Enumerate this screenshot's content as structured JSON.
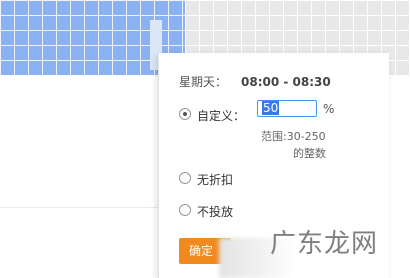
{
  "popup": {
    "day_label": "星期天：",
    "time_range": "08:00 - 08:30",
    "custom_label": "自定义：",
    "custom_value": "50",
    "percent_sign": "%",
    "hint_line1": "范围:30-250",
    "hint_line2": "的整数",
    "no_discount_label": "无折扣",
    "no_serve_label": "不投放",
    "confirm_label": "确定"
  },
  "watermark": "广东龙网"
}
